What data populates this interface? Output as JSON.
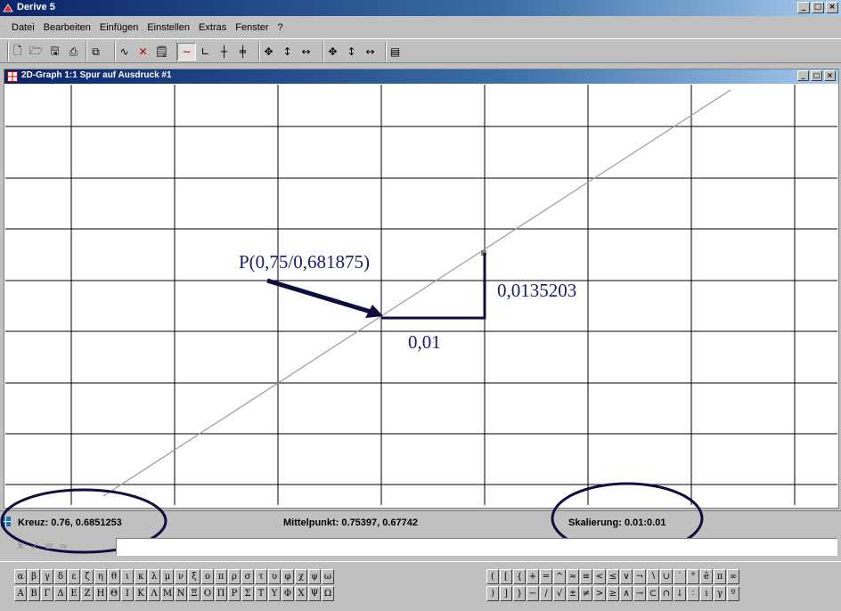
{
  "app": {
    "title": "Derive 5",
    "min": "_",
    "max": "□",
    "close": "×"
  },
  "menu": [
    "Datei",
    "Bearbeiten",
    "Einfügen",
    "Einstellen",
    "Extras",
    "Fenster",
    "?"
  ],
  "graph_window": {
    "title": "2D-Graph 1:1  Spur auf Ausdruck #1",
    "min": "_",
    "max": "□",
    "close": "×"
  },
  "annotations": {
    "point_label": "P(0,75/0,681875)",
    "dx_label": "0,01",
    "dy_label": "0,0135203"
  },
  "status": {
    "kreuz": "Kreuz: 0.76, 0.6851253",
    "mittelpunkt": "Mittelpunkt: 0.75397, 0.67742",
    "skalierung": "Skalierung: 0.01:0.01"
  },
  "entry": {
    "value": ""
  },
  "greek_lower": [
    "α",
    "β",
    "γ",
    "δ",
    "ε",
    "ζ",
    "η",
    "θ",
    "ι",
    "κ",
    "λ",
    "μ",
    "ν",
    "ξ",
    "ο",
    "π",
    "ρ",
    "σ",
    "τ",
    "υ",
    "φ",
    "χ",
    "ψ",
    "ω"
  ],
  "greek_upper": [
    "Α",
    "Β",
    "Γ",
    "Δ",
    "Ε",
    "Ζ",
    "Η",
    "Θ",
    "Ι",
    "Κ",
    "Λ",
    "Μ",
    "Ν",
    "Ξ",
    "Ο",
    "Π",
    "Ρ",
    "Σ",
    "Τ",
    "Υ",
    "Φ",
    "Χ",
    "Ψ",
    "Ω"
  ],
  "math_row1": [
    "(",
    "[",
    "{",
    "+",
    "=",
    "^",
    "≈",
    "≡",
    "<",
    "≤",
    "∨",
    "¬",
    "∖",
    "∪",
    "˙",
    "°",
    "ê",
    "π",
    "∞"
  ],
  "math_row2": [
    ")",
    "]",
    "}",
    "−",
    "/",
    "√",
    "±",
    "≠",
    ">",
    "≥",
    "∧",
    "→",
    "⊂",
    "∩",
    "↓",
    "∶",
    "ı",
    "γ",
    "º"
  ],
  "colors": {
    "title_bar": "#0a246a",
    "annotation": "#1a1a6e",
    "ellipse": "#0d0d40",
    "grid": "#000000",
    "curve": "#9a9a9a"
  }
}
